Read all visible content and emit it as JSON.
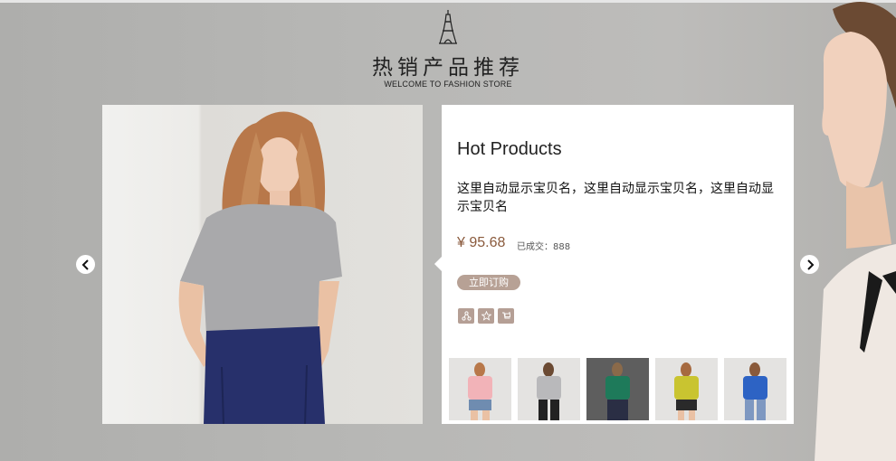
{
  "header": {
    "title_cn": "热销产品推荐",
    "title_en": "WELCOME TO FASHION STORE",
    "logo_icon": "eiffel-tower-icon"
  },
  "product": {
    "name": "Hot Products",
    "description": "这里自动显示宝贝名，这里自动显示宝贝名，这里自动显示宝贝名",
    "price": "¥ 95.68",
    "sold_label": "已成交：888",
    "buy_label": "立即订购",
    "actions": [
      {
        "icon": "share-icon"
      },
      {
        "icon": "star-icon"
      },
      {
        "icon": "cart-icon"
      }
    ],
    "thumbnails": [
      {
        "top_color": "#f2b3b8",
        "bottom_color": "#6f8cb0",
        "bg": "#e4e3e1"
      },
      {
        "top_color": "#b9b9bb",
        "bottom_color": "#222222",
        "bg": "#e4e3e1"
      },
      {
        "top_color": "#1e7a5a",
        "bottom_color": "#2a2e44",
        "bg": "#5e5e5e"
      },
      {
        "top_color": "#c9c430",
        "bottom_color": "#2a2a2a",
        "bg": "#e4e3e1"
      },
      {
        "top_color": "#2d63c4",
        "bottom_color": "#7e98c1",
        "bg": "#e4e3e1"
      }
    ]
  },
  "colors": {
    "accent": "#b7a195",
    "price": "#8a5a3c",
    "background": "#b7b7b5"
  },
  "nav": {
    "prev_icon": "chevron-left-icon",
    "next_icon": "chevron-right-icon"
  }
}
